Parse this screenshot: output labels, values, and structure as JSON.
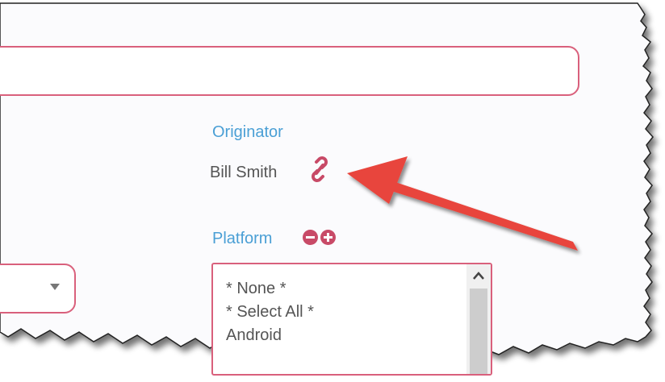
{
  "form": {
    "originator": {
      "label": "Originator",
      "value": "Bill Smith",
      "icon": "link-icon"
    },
    "platform": {
      "label": "Platform",
      "remove_icon": "minus-circle-icon",
      "add_icon": "plus-circle-icon",
      "options": [
        "* None *",
        "* Select All *",
        "Android"
      ]
    },
    "select_caret_icon": "caret-down-icon",
    "scroll_up_icon": "scroll-up-icon"
  },
  "colors": {
    "accent_border": "#d9607c",
    "label_blue": "#4a9fd5",
    "text_gray": "#555555",
    "icon_red": "#c84a67",
    "arrow_red": "#e8453c",
    "shadow": "#8a8a8a"
  }
}
